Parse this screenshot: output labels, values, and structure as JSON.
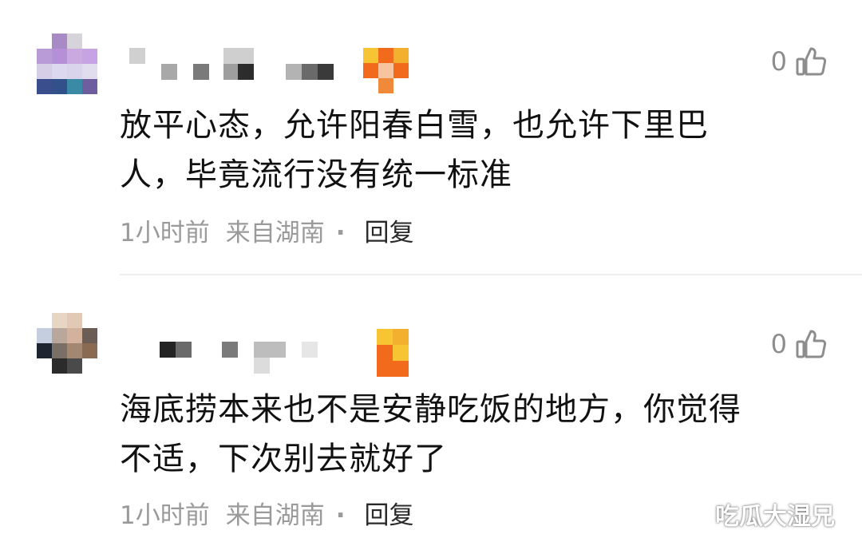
{
  "comments": [
    {
      "like_count": "0",
      "text_line1": "放平心态，允许阳春白雪，也允许下里巴",
      "text_line2": "人，毕竟流行没有统一标准",
      "time": "1小时前",
      "location": "来自湖南",
      "separator": "·",
      "reply_label": "回复"
    },
    {
      "like_count": "0",
      "text_line1": "海底捞本来也不是安静吃饭的地方，你觉得",
      "text_line2": "不适，下次别去就好了",
      "time": "1小时前",
      "location": "来自湖南",
      "separator": "·",
      "reply_label": "回复"
    }
  ],
  "watermark": {
    "text": "吃瓜大湿兄",
    "icon": "wechat-icon"
  },
  "icons": {
    "like": "thumbs-up-icon"
  },
  "colors": {
    "content_text": "#111111",
    "meta_text": "#9a9a9a",
    "reply_text": "#2a2a2a",
    "like_gray": "#8d8d8d",
    "badge_orange": "#f26a1b",
    "badge_yellow": "#f7c534",
    "divider": "#ececec"
  }
}
